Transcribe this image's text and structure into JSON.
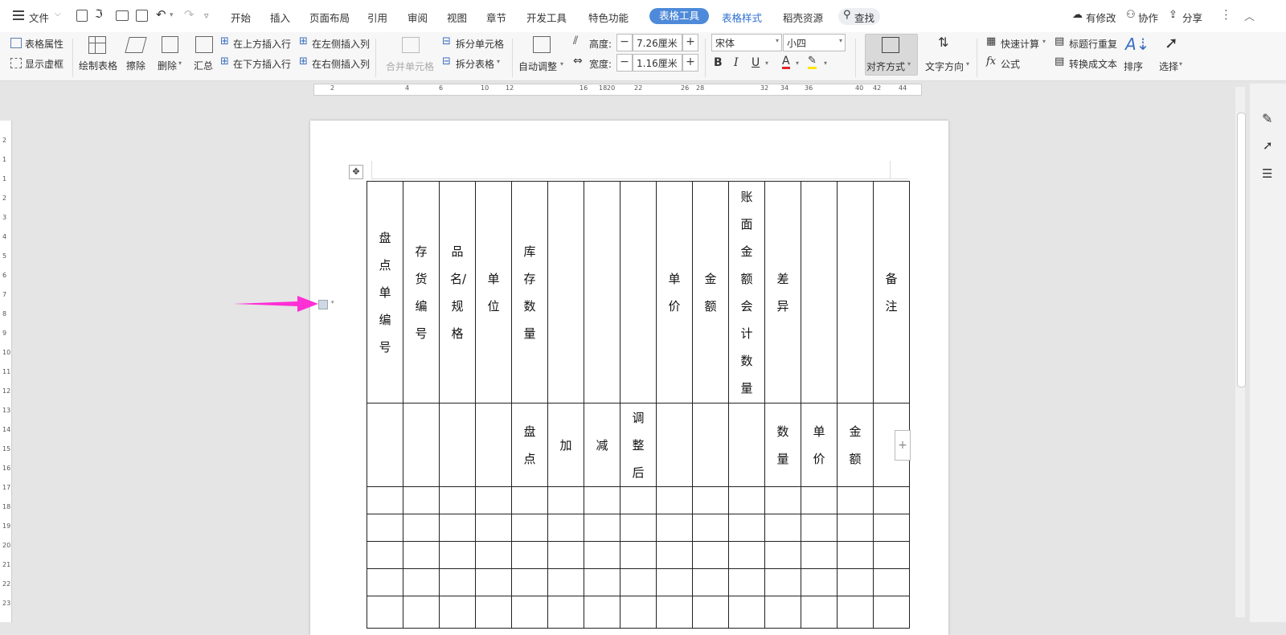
{
  "menu": {
    "file_label": "文件",
    "tabs": [
      "开始",
      "插入",
      "页面布局",
      "引用",
      "审阅",
      "视图",
      "章节",
      "开发工具",
      "特色功能"
    ],
    "active_tab": "表格工具",
    "tab_table_style": "表格样式",
    "tab_resource": "稻壳资源",
    "search_label": "查找",
    "changes_label": "有修改",
    "collab_label": "协作",
    "share_label": "分享"
  },
  "ribbon": {
    "table_props": "表格属性",
    "show_gridlines": "显示虚框",
    "draw_table": "绘制表格",
    "erase": "擦除",
    "delete": "删除",
    "summary": "汇总",
    "insert_above": "在上方插入行",
    "insert_below": "在下方插入行",
    "insert_left": "在左侧插入列",
    "insert_right": "在右侧插入列",
    "merge_cells": "合并单元格",
    "split_cells": "拆分单元格",
    "split_table": "拆分表格",
    "auto_fit": "自动调整",
    "height_label": "高度:",
    "height_value": "7.26厘米",
    "width_label": "宽度:",
    "width_value": "1.16厘米",
    "font_name": "宋体",
    "font_size": "小四",
    "align": "对齐方式",
    "text_direction": "文字方向",
    "quick_calc": "快速计算",
    "title_repeat": "标题行重复",
    "formula": "公式",
    "to_text": "转换成文本",
    "sort": "排序",
    "select": "选择"
  },
  "ruler": {
    "h_numbers": [
      "2",
      "4",
      "6",
      "10",
      "12",
      "16",
      "18",
      "20",
      "22",
      "26",
      "28",
      "32",
      "34",
      "36",
      "40",
      "42",
      "44"
    ],
    "v_numbers": [
      "2",
      "1",
      "1",
      "2",
      "3",
      "4",
      "5",
      "6",
      "7",
      "8",
      "9",
      "10",
      "11",
      "12",
      "13",
      "14",
      "15",
      "16",
      "17",
      "18",
      "19",
      "20",
      "21",
      "22",
      "23"
    ]
  },
  "table": {
    "header1": [
      "盘点单编号",
      "存货编号",
      "品名/规格",
      "单位",
      "库存数量",
      "",
      "",
      "",
      "单价",
      "金额",
      "账面金额会计数量",
      "差异",
      "",
      "",
      "备注"
    ],
    "header2": [
      "",
      "",
      "",
      "",
      "盘点",
      "加",
      "减",
      "调整后",
      "",
      "",
      "",
      "数量",
      "单价",
      "金额",
      ""
    ],
    "empty_rows": 5
  },
  "colors": {
    "accent": "#4e8ad9",
    "arrow": "#ff2fd6"
  }
}
